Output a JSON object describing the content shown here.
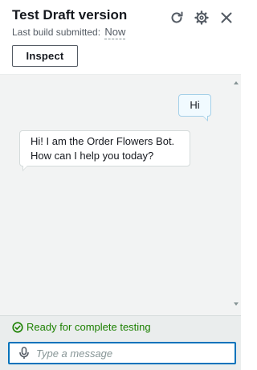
{
  "header": {
    "title": "Test Draft version",
    "subtitle_prefix": "Last build submitted:",
    "subtitle_value": "Now",
    "inspect_label": "Inspect",
    "icons": [
      "refresh-icon",
      "gear-icon",
      "close-icon"
    ]
  },
  "chat": {
    "messages": [
      {
        "role": "user",
        "text": "Hi"
      },
      {
        "role": "bot",
        "text": "Hi! I am the Order Flowers Bot. How can I help you today?"
      }
    ]
  },
  "status": {
    "text": "Ready for complete testing",
    "color": "#1d8102",
    "icon": "check-circle-icon"
  },
  "input": {
    "placeholder": "Type a message",
    "value": "",
    "icon": "microphone-icon",
    "focus_color": "#0073bb"
  }
}
